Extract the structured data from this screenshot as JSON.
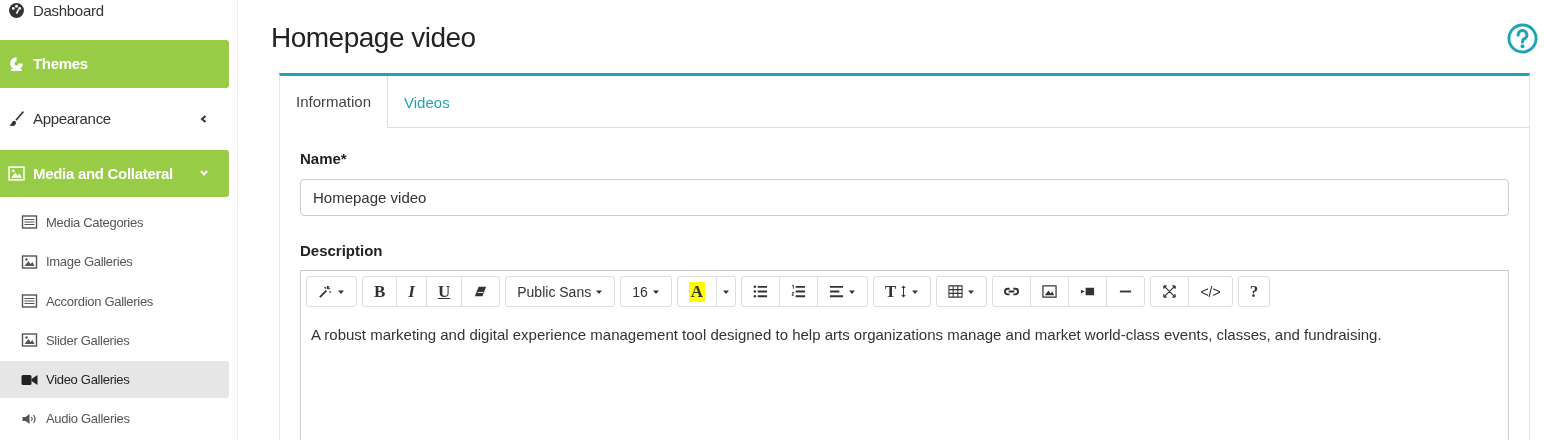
{
  "sidebar": {
    "items": [
      {
        "label": "Dashboard",
        "active": false
      },
      {
        "label": "Themes",
        "active": true
      },
      {
        "label": "Appearance",
        "active": false,
        "expanded": false
      },
      {
        "label": "Media and Collateral",
        "active": true,
        "expanded": true,
        "children": [
          {
            "label": "Media Categories",
            "selected": false
          },
          {
            "label": "Image Galleries",
            "selected": false
          },
          {
            "label": "Accordion Galleries",
            "selected": false
          },
          {
            "label": "Slider Galleries",
            "selected": false
          },
          {
            "label": "Video Galleries",
            "selected": true
          },
          {
            "label": "Audio Galleries",
            "selected": false
          }
        ]
      }
    ]
  },
  "page": {
    "title": "Homepage video"
  },
  "tabs": [
    {
      "label": "Information",
      "selected": true
    },
    {
      "label": "Videos",
      "selected": false
    }
  ],
  "form": {
    "name_label": "Name*",
    "name_value": "Homepage video",
    "description_label": "Description",
    "toolbar": [
      [
        {
          "kind": "magic",
          "dropdown": true
        }
      ],
      [
        {
          "kind": "bold",
          "label": "B"
        },
        {
          "kind": "italic",
          "label": "I"
        },
        {
          "kind": "underline",
          "label": "U"
        },
        {
          "kind": "eraser"
        }
      ],
      [
        {
          "kind": "font",
          "label": "Public Sans",
          "dropdown": true
        }
      ],
      [
        {
          "kind": "size",
          "label": "16",
          "dropdown": true
        }
      ],
      [
        {
          "kind": "highlight",
          "label": "A"
        },
        {
          "kind": "caret"
        }
      ],
      [
        {
          "kind": "ul"
        },
        {
          "kind": "ol"
        },
        {
          "kind": "align",
          "dropdown": true
        }
      ],
      [
        {
          "kind": "lineheight",
          "label": "T",
          "dropdown": true
        }
      ],
      [
        {
          "kind": "table",
          "dropdown": true
        }
      ],
      [
        {
          "kind": "link"
        },
        {
          "kind": "picture"
        },
        {
          "kind": "video"
        },
        {
          "kind": "hr"
        }
      ],
      [
        {
          "kind": "fullscreen"
        },
        {
          "kind": "code",
          "label": "</>"
        }
      ],
      [
        {
          "kind": "help",
          "label": "?"
        }
      ]
    ],
    "description_text": "A robust marketing and digital experience management tool designed to help arts organizations manage and market world-class events, classes, and fundraising."
  }
}
